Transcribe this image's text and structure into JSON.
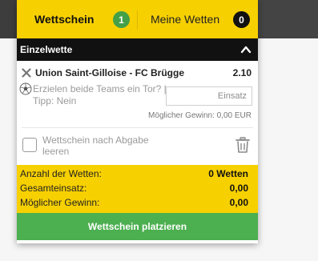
{
  "tabs": {
    "betslip": {
      "label": "Wettschein",
      "count": "1"
    },
    "my_bets": {
      "label": "Meine Wetten",
      "count": "0"
    }
  },
  "section": {
    "title": "Einzelwette"
  },
  "bet": {
    "match": "Union Saint-Gilloise - FC Brügge",
    "odds": "2.10",
    "market": "Erzielen beide Teams ein Tor? | Tipp: Nein",
    "stake_placeholder": "Einsatz",
    "possible_win_label": "Möglicher Gewinn:",
    "possible_win_value": "0,00 EUR"
  },
  "options": {
    "clear_after_submit_label": "Wettschein nach Abgabe leeren"
  },
  "summary": {
    "bet_count_label": "Anzahl der Wetten:",
    "bet_count_value": "0 Wetten",
    "total_stake_label": "Gesamteinsatz:",
    "total_stake_value": "0,00",
    "possible_win_label": "Möglicher Gewinn:",
    "possible_win_value": "0,00"
  },
  "actions": {
    "place_label": "Wettschein platzieren"
  },
  "colors": {
    "brand_yellow": "#f7d000",
    "success_green": "#4caf50",
    "badge_green": "#43a047",
    "header_black": "#111111"
  },
  "icons": {
    "collapse": "chevron-up-icon",
    "remove": "close-icon",
    "market": "football-icon",
    "trash": "trash-icon"
  }
}
